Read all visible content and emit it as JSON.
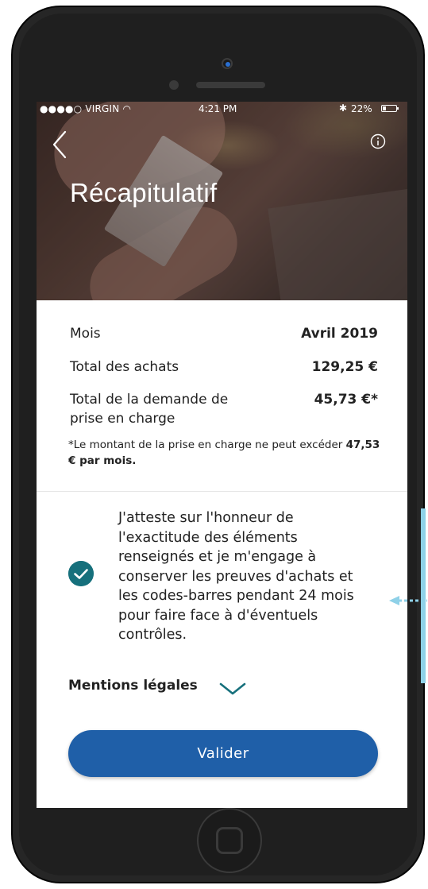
{
  "status_bar": {
    "carrier": "●●●●○ VIRGIN",
    "time": "4:21 PM",
    "battery_percent": "22%"
  },
  "header": {
    "title": "Récapitulatif",
    "back_icon": "chevron-left-icon",
    "info_icon": "info-circle-icon"
  },
  "summary": {
    "rows": [
      {
        "label": "Mois",
        "value": "Avril 2019"
      },
      {
        "label": "Total des achats",
        "value": "129,25 €"
      },
      {
        "label": "Total de la demande de prise en charge",
        "value": "45,73 €*"
      }
    ],
    "note_prefix": "*Le montant de la prise en charge ne peut excéder",
    "note_bold": "47,53 € par mois."
  },
  "attestation": {
    "checked": true,
    "text": "J'atteste sur l'honneur de l'exactitude des éléments renseignés et je m'engage à conserver les preuves d'achats et les codes-barres pendant 24 mois pour faire face à d'éventuels contrôles."
  },
  "legal": {
    "label": "Mentions légales",
    "icon": "chevron-down-icon"
  },
  "actions": {
    "validate_label": "Valider"
  },
  "colors": {
    "primary_button": "#1f5fa8",
    "check_teal": "#16707c",
    "annotation": "#8fd1e8"
  }
}
